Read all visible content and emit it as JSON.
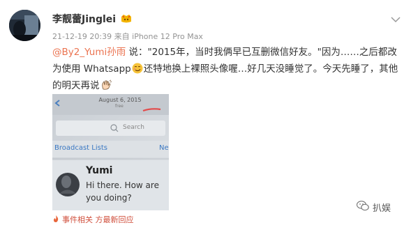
{
  "user": {
    "name": "李靓蕾Jinglei",
    "time": "21-12-19 20:39",
    "source": "来自 iPhone 12 Pro Max"
  },
  "post": {
    "mention": "@By2_Yumi孙雨",
    "text_part1": " 说：\"2015年，当时我俩早已互删微信好友。\"因为……之后都改为使用 Whatsapp",
    "text_part2": "还特地换上裸照头像喔…好几天没睡觉了。今天先睡了，其他的明天再说",
    "emoji_1": "smirk-face-icon",
    "emoji_2": "waving-hand-icon"
  },
  "embed": {
    "date": "August 6, 2015",
    "sub": "free",
    "search_placeholder": "Search",
    "broadcast": "Broadcast Lists",
    "new": "Ne",
    "contact_name": "Yumi",
    "message_line1": "Hi there. How are",
    "message_line2": "you doing?"
  },
  "footer": {
    "label": "事件相关 方最新回应"
  },
  "watermark": {
    "text": "扒娱"
  },
  "colors": {
    "accent": "#eb7350",
    "link_blue": "#1a7bd8",
    "meta_gray": "#939393"
  }
}
